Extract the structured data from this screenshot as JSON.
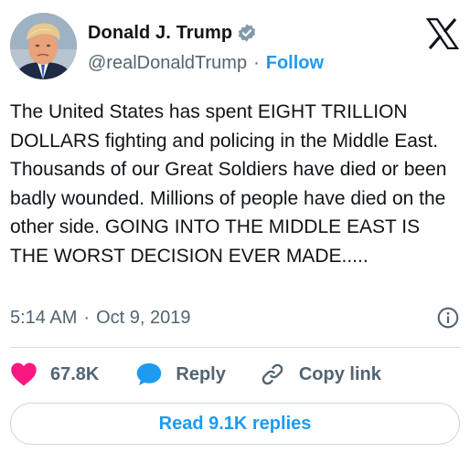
{
  "author": {
    "display_name": "Donald J. Trump",
    "handle": "@realDonaldTrump",
    "separator": "·",
    "follow_label": "Follow",
    "avatar_icon": "profile-photo",
    "verified_icon": "verified-badge-icon",
    "verified_color": "#829aab"
  },
  "brand": {
    "logo_icon": "x-logo-icon",
    "color": "#0f1419"
  },
  "tweet": {
    "text": "The United States has spent EIGHT TRILLION DOLLARS fighting and policing in the Middle East. Thousands of our Great Soldiers have died or been badly wounded. Millions of people have died on the other side. GOING INTO THE MIDDLE EAST IS THE WORST DECISION EVER MADE.....",
    "time": "5:14 AM",
    "separator": "·",
    "date": "Oct 9, 2019",
    "info_icon": "info-icon"
  },
  "actions": {
    "likes": "67.8K",
    "like_icon": "heart-icon",
    "like_color": "#f91880",
    "reply_label": "Reply",
    "reply_icon": "speech-bubble-icon",
    "reply_color": "#1d9bf0",
    "copy_label": "Copy link",
    "copy_icon": "link-icon"
  },
  "replies_button": {
    "label": "Read 9.1K replies"
  },
  "colors": {
    "accent": "#1d9bf0",
    "text": "#0f1419",
    "muted": "#536471",
    "border": "#cfd9de"
  }
}
